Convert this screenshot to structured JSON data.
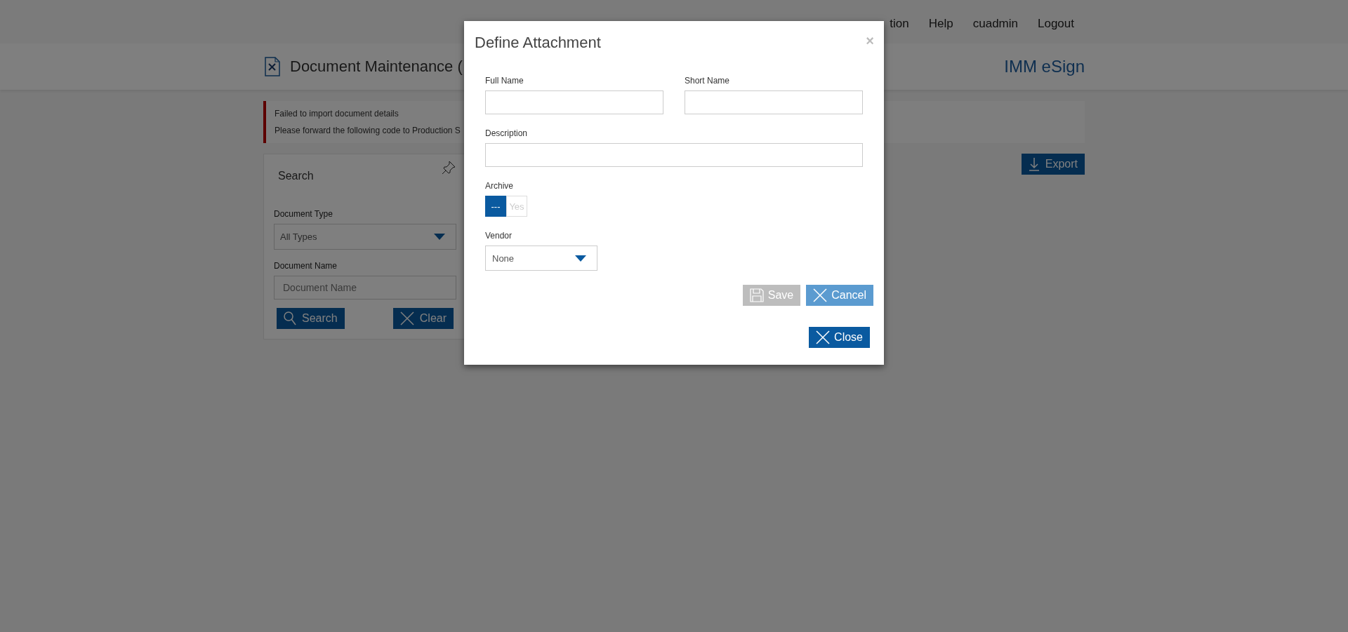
{
  "nav": {
    "items": [
      "tion",
      "Help",
      "cuadmin",
      "Logout"
    ]
  },
  "header": {
    "title": "Document Maintenance (",
    "brand": "IMM eSign"
  },
  "alert": {
    "lines": [
      "Failed to import document details",
      "Please forward the following code to Production S"
    ]
  },
  "search_panel": {
    "title": "Search",
    "fields": [
      {
        "kind": "select",
        "label": "Document Type",
        "value": "All Types"
      },
      {
        "kind": "input",
        "label": "Document Name",
        "placeholder": "Document Name"
      }
    ],
    "buttons": [
      {
        "kind": "search",
        "label": "Search"
      },
      {
        "kind": "clear",
        "label": "Clear"
      }
    ]
  },
  "export_button": {
    "label": "Export"
  },
  "dialog": {
    "title": "Define Attachment",
    "close_glyph": "×",
    "full_name": {
      "label": "Full Name"
    },
    "short_name": {
      "label": "Short Name"
    },
    "description": {
      "label": "Description"
    },
    "archive": {
      "label": "Archive",
      "options": [
        {
          "label": "---",
          "selected": true
        },
        {
          "label": "Yes",
          "selected": false
        }
      ]
    },
    "vendor": {
      "label": "Vendor",
      "value": "None"
    },
    "actions": [
      {
        "kind": "save",
        "label": "Save",
        "disabled": true
      },
      {
        "kind": "cancel",
        "label": "Cancel",
        "disabled": false
      }
    ],
    "footer_button": {
      "kind": "close",
      "label": "Close",
      "disabled": false
    }
  }
}
